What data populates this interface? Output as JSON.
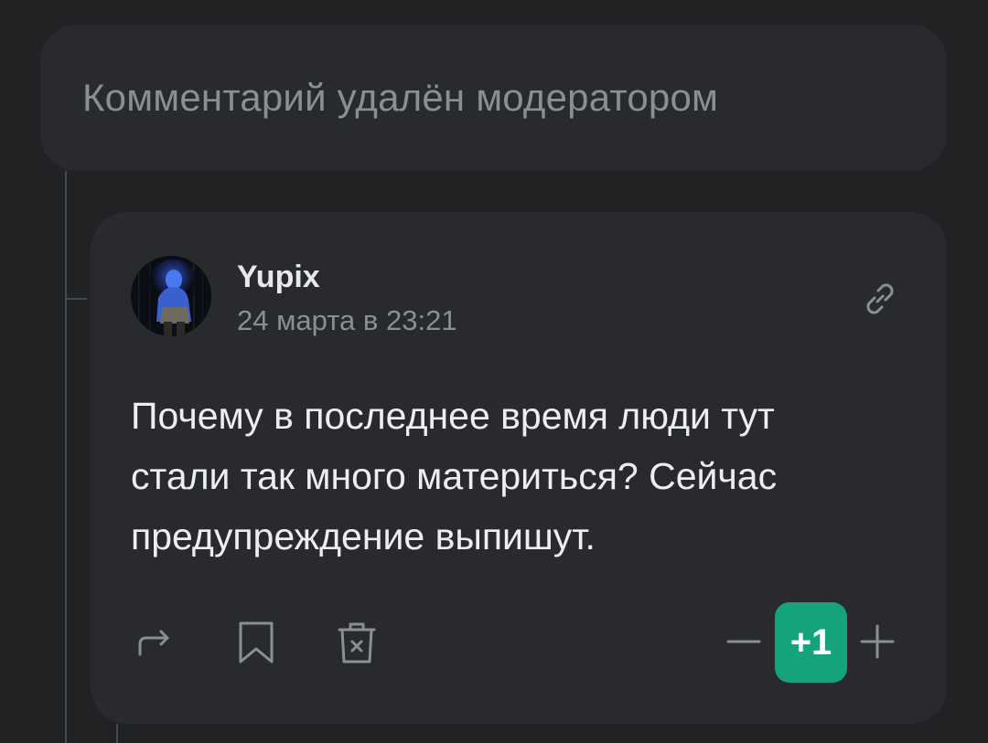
{
  "deleted_comment": {
    "text": "Комментарий удалён модератором"
  },
  "comment": {
    "author": "Yupix",
    "timestamp": "24 марта в 23:21",
    "text": "Почему в последнее время люди тут стали так много материться? Сейчас предупреждение выпишут.",
    "score": "+1"
  },
  "icons": {
    "link": "link-icon",
    "share": "share-arrow-icon",
    "bookmark": "bookmark-icon",
    "delete": "trash-icon",
    "minus": "minus-icon",
    "plus": "plus-icon"
  },
  "colors": {
    "background": "#202224",
    "card": "#282a2d",
    "muted_text": "#8b8e92",
    "score_badge": "#14a37c"
  }
}
